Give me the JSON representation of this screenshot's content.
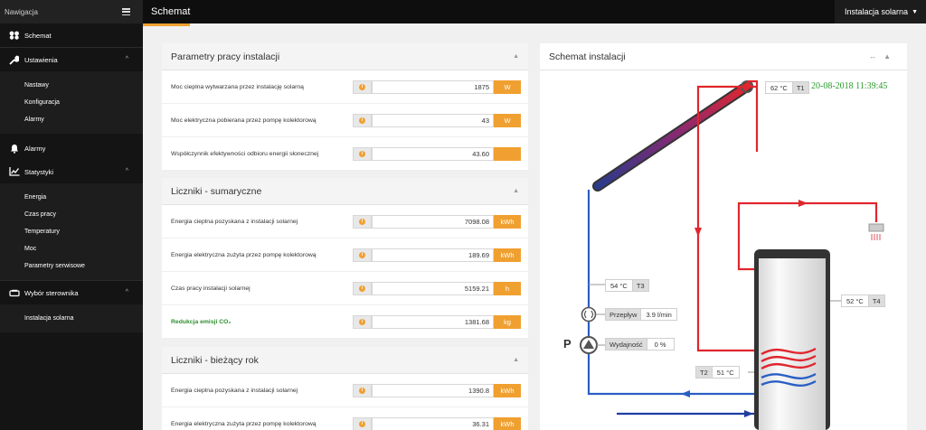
{
  "sidebar": {
    "title": "Nawigacja",
    "items": [
      {
        "label": "Schemat",
        "icon": "solar-panel-icon"
      },
      {
        "label": "Ustawienia",
        "icon": "wrench-icon",
        "subitems": [
          "Nastawy",
          "Konfiguracja",
          "Alarmy"
        ]
      },
      {
        "label": "Alarmy",
        "icon": "bell-icon"
      },
      {
        "label": "Statystyki",
        "icon": "chart-icon",
        "subitems": [
          "Energia",
          "Czas pracy",
          "Temperatury",
          "Moc",
          "Parametry serwisowe"
        ]
      },
      {
        "label": "Wybór sterownika",
        "icon": "device-icon",
        "subitems": [
          "Instalacja solarna"
        ]
      }
    ]
  },
  "topbar": {
    "title": "Schemat",
    "dropdown": "Instalacja solarna"
  },
  "params": {
    "title": "Parametry pracy instalacji",
    "rows": [
      {
        "label": "Moc cieplna wytwarzana przez instalację solarną",
        "value": "1875",
        "unit": "W"
      },
      {
        "label": "Moc elektryczna pobierana przez pompę kolektorową",
        "value": "43",
        "unit": "W"
      },
      {
        "label": "Współczynnik efektywności odbioru energii słonecznej",
        "value": "43.60",
        "unit": ""
      }
    ]
  },
  "counters_total": {
    "title": "Liczniki - sumaryczne",
    "rows": [
      {
        "label": "Energia cieplna pozyskana z instalacji solarnej",
        "value": "7098.08",
        "unit": "kWh"
      },
      {
        "label": "Energia elektryczna zużyta przez pompę kolektorową",
        "value": "189.69",
        "unit": "kWh"
      },
      {
        "label": "Czas pracy instalacji solarnej",
        "value": "5159.21",
        "unit": "h"
      },
      {
        "label": "Redukcja emisji CO₂",
        "value": "1381.68",
        "unit": "kg"
      }
    ]
  },
  "counters_year": {
    "title": "Liczniki - bieżący rok",
    "rows": [
      {
        "label": "Energia cieplna pozyskana z instalacji solarnej",
        "value": "1390.8",
        "unit": "kWh"
      },
      {
        "label": "Energia elektryczna zużyta przez pompę kolektorową",
        "value": "36.31",
        "unit": "kWh"
      }
    ]
  },
  "schema": {
    "title": "Schemat instalacji",
    "datetime": "20-08-2018 11:39:45",
    "t1": {
      "value": "62 °C",
      "tag": "T1"
    },
    "t2": {
      "value": "51 °C",
      "tag": "T2"
    },
    "t3": {
      "value": "54 °C",
      "tag": "T3"
    },
    "t4": {
      "value": "52 °C",
      "tag": "T4"
    },
    "flow": {
      "label": "Przepływ",
      "value": "3.9 l/min"
    },
    "efficiency": {
      "label": "Wydajność",
      "value": "0 %"
    },
    "pump_letter": "P",
    "colors": {
      "hot": "#e0262e",
      "cold": "#2a5fc4",
      "accent": "#f0a030"
    }
  }
}
